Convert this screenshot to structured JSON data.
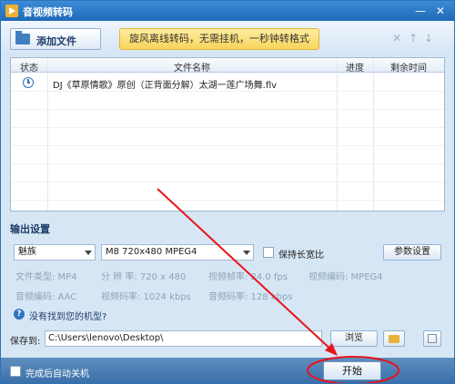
{
  "window": {
    "title": "音视频转码"
  },
  "toolbar": {
    "add_file_label": "添加文件",
    "promo_text": "旋风离线转码，无需挂机，一秒钟转格式",
    "icons": [
      "close-icon",
      "up-arrow-icon",
      "down-arrow-icon"
    ]
  },
  "table": {
    "headers": [
      "状态",
      "文件名称",
      "进度",
      "剩余时间"
    ],
    "rows": [
      {
        "status_icon": "clock-icon",
        "filename": "DJ《草原情歌》原创（正背面分解）太湖一莲广场舞.flv",
        "progress": "",
        "remaining": ""
      }
    ]
  },
  "output": {
    "section_title": "输出设置",
    "device": "魅族",
    "format": "M8 720x480 MPEG4",
    "keep_ratio_label": "保持长宽比",
    "param_button": "参数设置",
    "params": {
      "file_type": "文件类型:  MP4",
      "resolution": "分 辨 率:   720 x 480",
      "frame_rate": "视频帧率:   24.0 fps",
      "video_codec": "视频编码:   MPEG4",
      "audio_codec": "音频编码:  AAC",
      "video_bitrate": "视频码率:   1024 kbps",
      "audio_bitrate": "音频码率:   128 kbps"
    },
    "help_text": "没有找到您的机型?"
  },
  "save": {
    "label": "保存到:",
    "path": "C:\\Users\\lenovo\\Desktop\\",
    "browse_label": "浏览"
  },
  "footer": {
    "shutdown_label": "完成后自动关机",
    "start_label": "开始"
  },
  "colors": {
    "titlebar": "#2e73b8",
    "annotation": "#e8141b",
    "promo": "#f8d45a"
  }
}
